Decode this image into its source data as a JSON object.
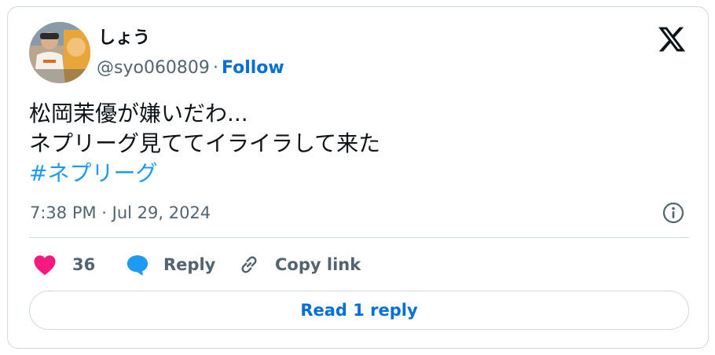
{
  "author": {
    "display_name": "しょう",
    "handle": "@syo060809",
    "separator": "·",
    "follow_label": "Follow",
    "avatar_icon": "user-avatar-photo"
  },
  "tweet": {
    "lines": [
      "松岡茉優が嫌いだわ...",
      "ネプリーグ見ててイライラして来た"
    ],
    "hashtag": "#ネプリーグ",
    "timestamp": "7:38 PM · Jul 29, 2024"
  },
  "actions": {
    "like_count": "36",
    "reply_label": "Reply",
    "copy_link_label": "Copy link"
  },
  "read_reply_label": "Read 1 reply",
  "icons": {
    "brand": "x-logo-icon",
    "info": "info-icon",
    "like": "heart-icon",
    "reply": "speech-bubble-icon",
    "copy": "link-icon"
  },
  "colors": {
    "text": "#0f1419",
    "secondary": "#536471",
    "link": "#006fd6",
    "hashtag": "#1d9bf0",
    "like": "#f91880",
    "border": "#cfd9de"
  }
}
